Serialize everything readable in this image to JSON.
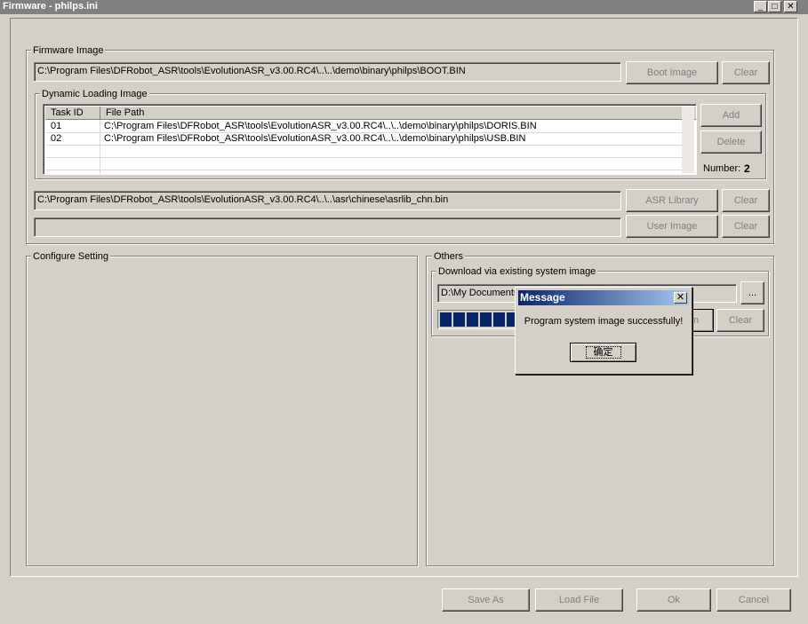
{
  "window": {
    "title": "Firmware - philps.ini",
    "min_glyph": "_",
    "max_glyph": "□",
    "close_glyph": "✕"
  },
  "firmware_image": {
    "group_label": "Firmware Image",
    "boot_path": "C:\\Program Files\\DFRobot_ASR\\tools\\EvolutionASR_v3.00.RC4\\..\\..\\demo\\binary\\philps\\BOOT.BIN",
    "boot_button": "Boot Image",
    "boot_clear": "Clear",
    "dynamic": {
      "group_label": "Dynamic Loading Image",
      "columns": [
        "Task ID",
        "File Path"
      ],
      "rows": [
        {
          "id": "01",
          "path": "C:\\Program Files\\DFRobot_ASR\\tools\\EvolutionASR_v3.00.RC4\\..\\..\\demo\\binary\\philps\\DORIS.BIN"
        },
        {
          "id": "02",
          "path": "C:\\Program Files\\DFRobot_ASR\\tools\\EvolutionASR_v3.00.RC4\\..\\..\\demo\\binary\\philps\\USB.BIN"
        }
      ],
      "add_button": "Add",
      "delete_button": "Delete",
      "number_label": "Number:",
      "number_value": "2"
    },
    "asr_path": "C:\\Program Files\\DFRobot_ASR\\tools\\EvolutionASR_v3.00.RC4\\..\\..\\asr\\chinese\\asrlib_chn.bin",
    "asr_button": "ASR Library",
    "asr_clear": "Clear",
    "user_path": "",
    "user_button": "User Image",
    "user_clear": "Clear"
  },
  "configure": {
    "group_label": "Configure Setting"
  },
  "others": {
    "group_label": "Others",
    "download_group_label": "Download via existing system image",
    "download_path": "D:\\My Documents",
    "browse_button": "...",
    "program_button_partial": "m",
    "clear_button": "Clear",
    "progress_blocks": 6
  },
  "dialog": {
    "title": "Message",
    "close_glyph": "✕",
    "message": "Program system image successfully!",
    "ok_label": "确定"
  },
  "footer": {
    "save_as": "Save As",
    "load_file": "Load File",
    "ok": "Ok",
    "cancel": "Cancel"
  },
  "colors": {
    "face": "#d4d0c8",
    "title_inactive": "#808080",
    "progress": "#0a246a",
    "dialog_title_start": "#0a246a",
    "dialog_title_end": "#a6caf0"
  }
}
